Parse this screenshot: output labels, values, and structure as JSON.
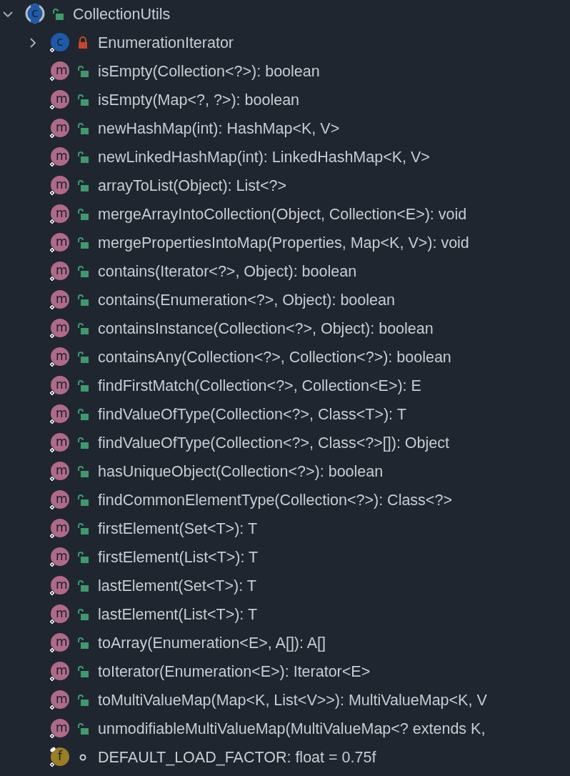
{
  "tree": {
    "label": "CollectionUtils",
    "kind": "class",
    "badge": "c",
    "access": {
      "kind": "open-lock",
      "color": "#3f9a6b"
    },
    "expanded": true,
    "children": [
      {
        "label": "EnumerationIterator",
        "kind": "class",
        "badge": "c",
        "access": {
          "kind": "closed-lock",
          "color": "#c8452c"
        },
        "expanded": false
      },
      {
        "label": "isEmpty(Collection<?>): boolean",
        "kind": "method",
        "badge": "m",
        "access": {
          "kind": "open-lock",
          "color": "#3f9a6b"
        }
      },
      {
        "label": "isEmpty(Map<?, ?>): boolean",
        "kind": "method",
        "badge": "m",
        "access": {
          "kind": "open-lock",
          "color": "#3f9a6b"
        }
      },
      {
        "label": "newHashMap(int): HashMap<K, V>",
        "kind": "method",
        "badge": "m",
        "access": {
          "kind": "open-lock",
          "color": "#3f9a6b"
        }
      },
      {
        "label": "newLinkedHashMap(int): LinkedHashMap<K, V>",
        "kind": "method",
        "badge": "m",
        "access": {
          "kind": "open-lock",
          "color": "#3f9a6b"
        }
      },
      {
        "label": "arrayToList(Object): List<?>",
        "kind": "method",
        "badge": "m",
        "access": {
          "kind": "open-lock",
          "color": "#3f9a6b"
        }
      },
      {
        "label": "mergeArrayIntoCollection(Object, Collection<E>): void",
        "kind": "method",
        "badge": "m",
        "access": {
          "kind": "open-lock",
          "color": "#3f9a6b"
        }
      },
      {
        "label": "mergePropertiesIntoMap(Properties, Map<K, V>): void",
        "kind": "method",
        "badge": "m",
        "access": {
          "kind": "open-lock",
          "color": "#3f9a6b"
        }
      },
      {
        "label": "contains(Iterator<?>, Object): boolean",
        "kind": "method",
        "badge": "m",
        "access": {
          "kind": "open-lock",
          "color": "#3f9a6b"
        }
      },
      {
        "label": "contains(Enumeration<?>, Object): boolean",
        "kind": "method",
        "badge": "m",
        "access": {
          "kind": "open-lock",
          "color": "#3f9a6b"
        }
      },
      {
        "label": "containsInstance(Collection<?>, Object): boolean",
        "kind": "method",
        "badge": "m",
        "access": {
          "kind": "open-lock",
          "color": "#3f9a6b"
        }
      },
      {
        "label": "containsAny(Collection<?>, Collection<?>): boolean",
        "kind": "method",
        "badge": "m",
        "access": {
          "kind": "open-lock",
          "color": "#3f9a6b"
        }
      },
      {
        "label": "findFirstMatch(Collection<?>, Collection<E>): E",
        "kind": "method",
        "badge": "m",
        "access": {
          "kind": "open-lock",
          "color": "#3f9a6b"
        }
      },
      {
        "label": "findValueOfType(Collection<?>, Class<T>): T",
        "kind": "method",
        "badge": "m",
        "access": {
          "kind": "open-lock",
          "color": "#3f9a6b"
        }
      },
      {
        "label": "findValueOfType(Collection<?>, Class<?>[]): Object",
        "kind": "method",
        "badge": "m",
        "access": {
          "kind": "open-lock",
          "color": "#3f9a6b"
        }
      },
      {
        "label": "hasUniqueObject(Collection<?>): boolean",
        "kind": "method",
        "badge": "m",
        "access": {
          "kind": "open-lock",
          "color": "#3f9a6b"
        }
      },
      {
        "label": "findCommonElementType(Collection<?>): Class<?>",
        "kind": "method",
        "badge": "m",
        "access": {
          "kind": "open-lock",
          "color": "#3f9a6b"
        }
      },
      {
        "label": "firstElement(Set<T>): T",
        "kind": "method",
        "badge": "m",
        "access": {
          "kind": "open-lock",
          "color": "#3f9a6b"
        }
      },
      {
        "label": "firstElement(List<T>): T",
        "kind": "method",
        "badge": "m",
        "access": {
          "kind": "open-lock",
          "color": "#3f9a6b"
        }
      },
      {
        "label": "lastElement(Set<T>): T",
        "kind": "method",
        "badge": "m",
        "access": {
          "kind": "open-lock",
          "color": "#3f9a6b"
        }
      },
      {
        "label": "lastElement(List<T>): T",
        "kind": "method",
        "badge": "m",
        "access": {
          "kind": "open-lock",
          "color": "#3f9a6b"
        }
      },
      {
        "label": "toArray(Enumeration<E>, A[]): A[]",
        "kind": "method",
        "badge": "m",
        "access": {
          "kind": "open-lock",
          "color": "#3f9a6b"
        }
      },
      {
        "label": "toIterator(Enumeration<E>): Iterator<E>",
        "kind": "method",
        "badge": "m",
        "access": {
          "kind": "open-lock",
          "color": "#3f9a6b"
        }
      },
      {
        "label": "toMultiValueMap(Map<K, List<V>>): MultiValueMap<K, V",
        "kind": "method",
        "badge": "m",
        "access": {
          "kind": "open-lock",
          "color": "#3f9a6b"
        }
      },
      {
        "label": "unmodifiableMultiValueMap(MultiValueMap<? extends K,",
        "kind": "method",
        "badge": "m",
        "access": {
          "kind": "open-lock",
          "color": "#3f9a6b"
        }
      },
      {
        "label": "DEFAULT_LOAD_FACTOR: float = 0.75f",
        "kind": "field",
        "badge": "f",
        "access": {
          "kind": "dot"
        }
      }
    ]
  }
}
